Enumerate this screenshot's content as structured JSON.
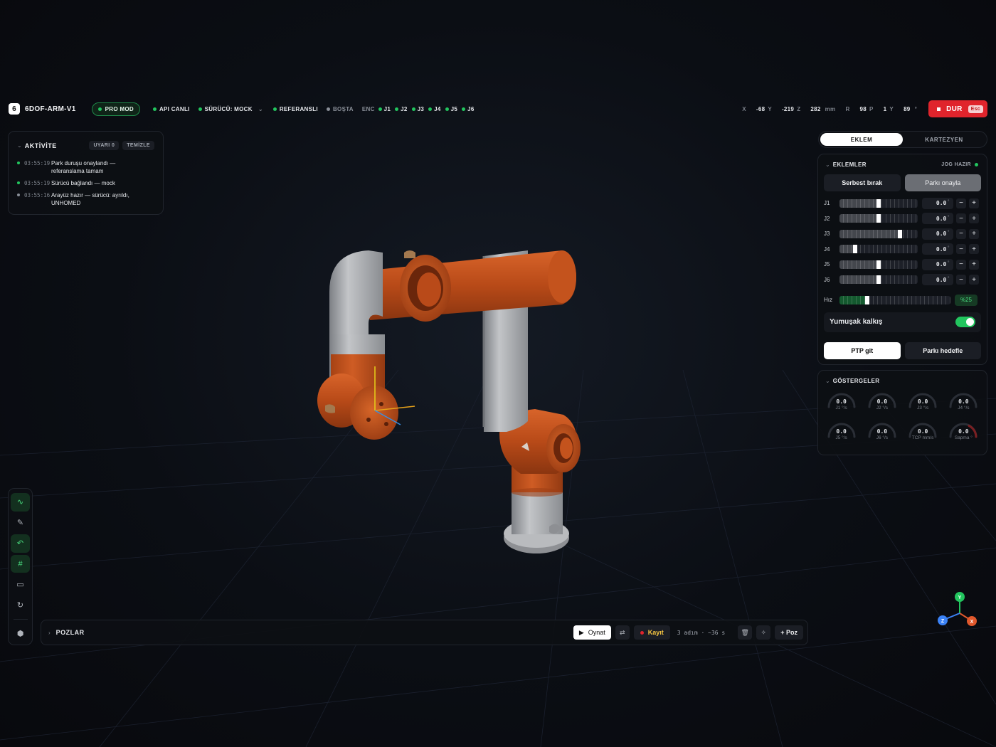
{
  "app": {
    "logo_text": "6",
    "title": "6DOF-ARM-V1"
  },
  "status": {
    "pro_mode": "PRO MOD",
    "api": "API CANLI",
    "driver": "SÜRÜCÜ: MOCK",
    "referenced": "REFERANSLI",
    "idle": "BOŞTA",
    "enc_label": "ENC",
    "encoders": [
      "J1",
      "J2",
      "J3",
      "J4",
      "J5",
      "J6"
    ]
  },
  "coords": {
    "x_label": "X",
    "x_value": "-68",
    "y_label": "Y",
    "y_value": "-219",
    "z_label": "Z",
    "z_value": "282",
    "xyz_unit": "mm",
    "r_label": "R",
    "r_value": "98",
    "p_label": "P",
    "p_value": "1",
    "yaw_label": "Y",
    "yaw_value": "89",
    "rpy_unit": "°"
  },
  "stop": {
    "label": "DUR",
    "key": "Esc"
  },
  "activity": {
    "title": "AKTİVİTE",
    "warnings_chip": "UYARI 0",
    "clear_chip": "TEMİZLE",
    "entries": [
      {
        "time": "03:55:19",
        "text": "Park duruşu onaylandı — referanslama tamam",
        "status": "ok"
      },
      {
        "time": "03:55:19",
        "text": "Sürücü bağlandı — mock",
        "status": "ok"
      },
      {
        "time": "03:55:16",
        "text": "Arayüz hazır — sürücü: ayrıldı, UNHOMED",
        "status": "info"
      }
    ]
  },
  "mode_tabs": {
    "joint": "EKLEM",
    "cartesian": "KARTEZYEN",
    "active": "joint"
  },
  "joints": {
    "title": "EKLEMLER",
    "ready": "JOG HAZIR",
    "release_btn": "Serbest bırak",
    "confirm_park_btn": "Parkı onayla",
    "rows": [
      {
        "label": "J1",
        "value": "0.0",
        "unit": "°",
        "position": 0.5
      },
      {
        "label": "J2",
        "value": "0.0",
        "unit": "°",
        "position": 0.5
      },
      {
        "label": "J3",
        "value": "0.0",
        "unit": "°",
        "position": 0.77
      },
      {
        "label": "J4",
        "value": "0.0",
        "unit": "°",
        "position": 0.2
      },
      {
        "label": "J5",
        "value": "0.0",
        "unit": "°",
        "position": 0.5
      },
      {
        "label": "J6",
        "value": "0.0",
        "unit": "°",
        "position": 0.5
      }
    ],
    "speed_label": "Hız",
    "speed_value": "%25",
    "speed_fraction": 0.25,
    "soft_start_label": "Yumuşak kalkış",
    "soft_start_on": true,
    "ptp_btn": "PTP git",
    "park_target_btn": "Parkı hedefle"
  },
  "gauges": {
    "title": "GÖSTERGELER",
    "items": [
      {
        "value": "0.0",
        "label": "J1 °/s"
      },
      {
        "value": "0.0",
        "label": "J2 °/s"
      },
      {
        "value": "0.0",
        "label": "J3 °/s"
      },
      {
        "value": "0.0",
        "label": "J4 °/s"
      },
      {
        "value": "0.0",
        "label": "J5 °/s"
      },
      {
        "value": "0.0",
        "label": "J6 °/s"
      },
      {
        "value": "0.0",
        "label": "TCP mm/s"
      },
      {
        "value": "0.0",
        "label": "Sapma °"
      }
    ]
  },
  "poses": {
    "title": "POZLAR",
    "play": "Oynat",
    "record": "Kayıt",
    "steps": "3 adım · ~36 s",
    "add": "+ Poz"
  },
  "axes_gizmo": {
    "x": "X",
    "y": "Y",
    "z": "Z"
  },
  "colors": {
    "accent_green": "#22c55e",
    "stop_red": "#e0242c",
    "robot_orange": "#c4531d",
    "robot_grey": "#a8aaae"
  }
}
